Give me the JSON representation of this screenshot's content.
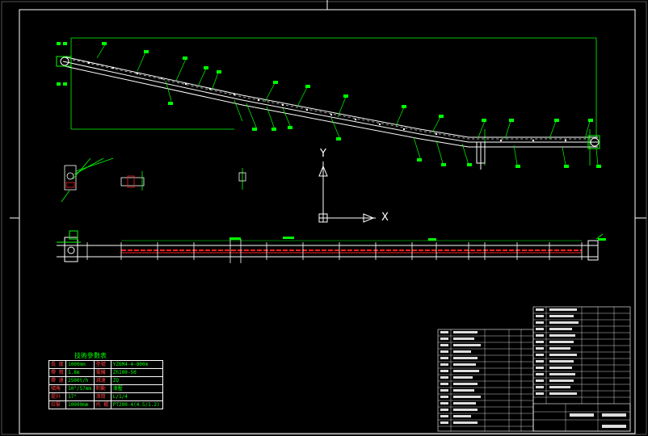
{
  "drawing": {
    "axis_x_label": "X",
    "axis_y_label": "Y"
  },
  "spec_table": {
    "title": "技術參數表",
    "rows": [
      [
        "長 度",
        "1000mm",
        "型號",
        "YZ6M4-4-800m"
      ],
      [
        "帶 寬",
        "1.8m",
        "電機",
        "Zh100-50"
      ],
      [
        "帶 速",
        "2500t/h",
        "減速",
        "ZQ"
      ],
      [
        "傾角",
        "10°/57mm",
        "制動",
        "液壓"
      ],
      [
        "提升",
        "17°",
        "滾筒",
        "L/1/4"
      ],
      [
        "拉緊",
        "10000mm",
        "托 輥",
        "PT200-4(4.5/1.2)"
      ]
    ]
  },
  "colors": {
    "background": "#000000",
    "frame": "#ffffff",
    "conveyor": "#ffffff",
    "callout": "#00ff00",
    "rail": "#ff2020",
    "accent_cyan": "#00ffff"
  }
}
